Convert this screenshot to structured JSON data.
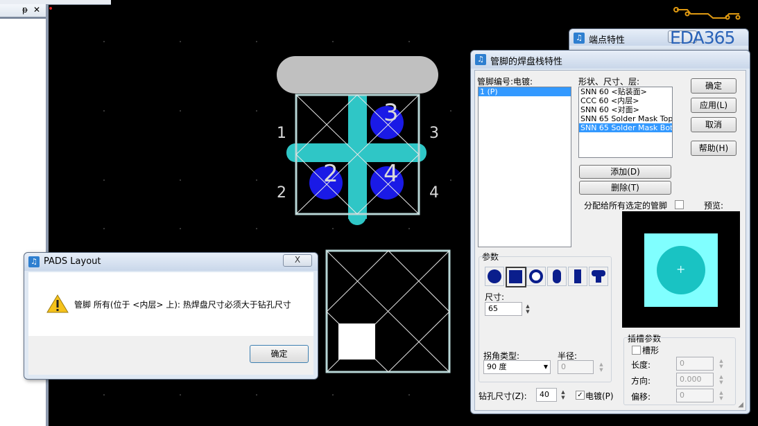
{
  "watermark": {
    "logo_text": "EDA365"
  },
  "left_panel": {
    "pin_glyph": "ᵽ",
    "close_glyph": "✕"
  },
  "pcb": {
    "labels": [
      "1",
      "3",
      "2",
      "4"
    ],
    "pin_numbers": [
      "3",
      "2",
      "4"
    ]
  },
  "pads_alert": {
    "title": "PADS Layout",
    "close_glyph": "X",
    "message": "管脚 所有(位于 <内层> 上): 热焊盘尺寸必须大于钻孔尺寸",
    "ok_label": "确定"
  },
  "endpoint_window": {
    "title": "端点特性"
  },
  "padstack": {
    "title": "管脚的焊盘栈特性",
    "pin_list_label": "管脚编号:电镀:",
    "pin_items": [
      "1 (P)"
    ],
    "shape_label": "形状、尺寸、层:",
    "shape_items": [
      "SNN 60 <贴装面>",
      "CCC 60 <内层>",
      "SNN 60 <对面>",
      "SNN 65 Solder Mask Top",
      "SNN 65 Solder Mask Bottom"
    ],
    "selected_shape_index": 4,
    "ok_label": "确定",
    "apply_label": "应用(L)",
    "cancel_label": "取消",
    "help_label": "帮助(H)",
    "add_label": "添加(D)",
    "delete_label": "删除(T)",
    "assign_label": "分配给所有选定的管脚",
    "preview_label": "预览:",
    "params_label": "参数",
    "size_label": "尺寸:",
    "size_value": "65",
    "corner_type_label": "拐角类型:",
    "corner_type_value": "90 度",
    "radius_label": "半径:",
    "radius_value": "0",
    "slot_params_label": "插槽参数",
    "slot_label": "槽形",
    "length_label": "长度:",
    "length_value": "0",
    "direction_label": "方向:",
    "direction_value": "0.000",
    "offset_label": "偏移:",
    "offset_value": "0",
    "drill_label": "钻孔尺寸(Z):",
    "drill_value": "40",
    "plated_label": "电镀(P)",
    "plated_checked": true,
    "slot_checked": false,
    "assign_checked": false
  },
  "colors": {
    "canvas": "#000000",
    "trace": "#2fc6c6",
    "pad_blue": "#1a1ae6",
    "outline": "#b7d6d6",
    "pad_gray": "#c0c0c0",
    "preview_square": "#80ffff",
    "preview_circle": "#19c3c3"
  }
}
